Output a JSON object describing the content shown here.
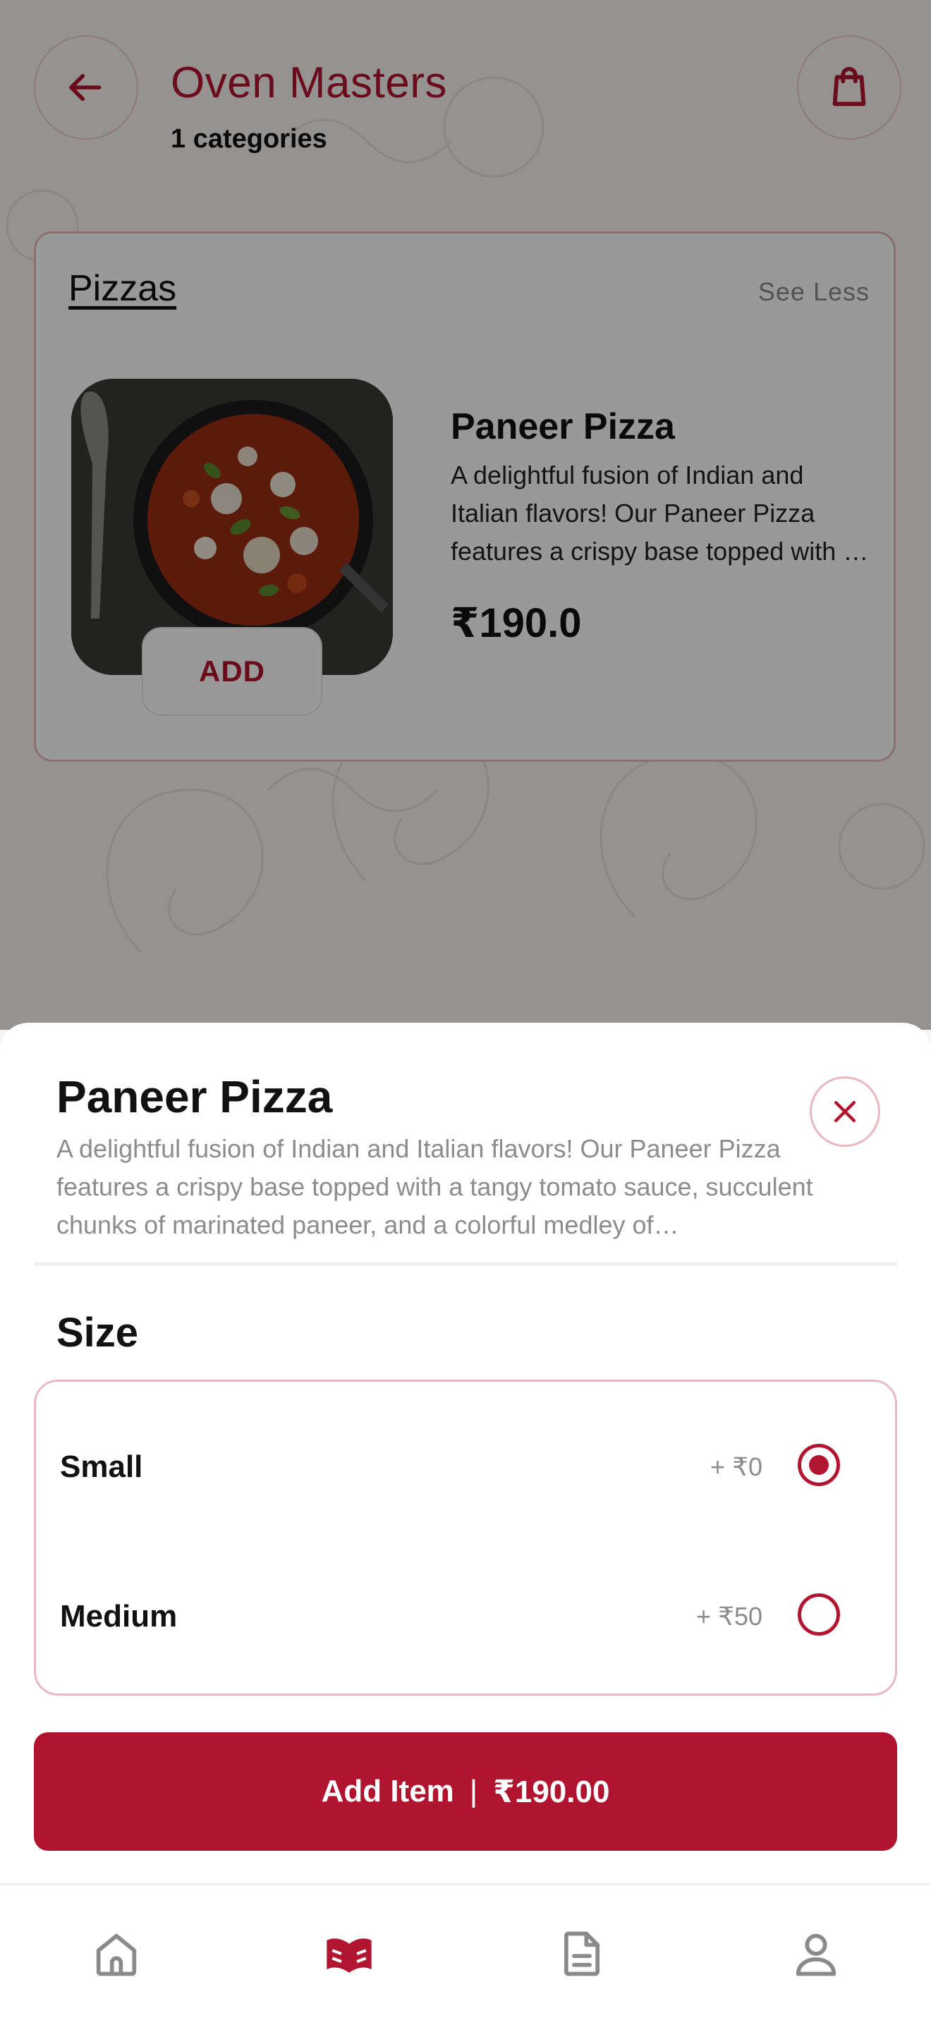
{
  "header": {
    "restaurant_name": "Oven Masters",
    "categories_count": "1 categories"
  },
  "category": {
    "name": "Pizzas",
    "toggle_label": "See Less",
    "item": {
      "name": "Paneer Pizza",
      "description": "A delightful fusion of Indian and Italian flavors! Our Paneer Pizza features a crispy base topped with …",
      "price": "₹190.0",
      "add_label": "ADD"
    }
  },
  "sheet": {
    "title": "Paneer Pizza",
    "description": "A delightful fusion of Indian and Italian flavors! Our Paneer Pizza features a crispy base topped with a tangy tomato sauce, succulent chunks of marinated paneer, and a colorful medley of…",
    "size_heading": "Size",
    "options": [
      {
        "label": "Small",
        "price": "+ ₹0",
        "selected": true
      },
      {
        "label": "Medium",
        "price": "+ ₹50",
        "selected": false
      }
    ],
    "add_button": {
      "label": "Add Item",
      "separator": "|",
      "total": "₹190.00"
    }
  },
  "nav": {
    "items": [
      {
        "icon": "home-icon",
        "active": false
      },
      {
        "icon": "menu-book-icon",
        "active": true
      },
      {
        "icon": "orders-document-icon",
        "active": false
      },
      {
        "icon": "profile-icon",
        "active": false
      }
    ]
  },
  "colors": {
    "brand": "#b0142e",
    "title_red": "#b21530",
    "border_pink": "#e9b8c4",
    "muted_text": "#8c8c8c",
    "icon_gray": "#8a8a8a"
  }
}
